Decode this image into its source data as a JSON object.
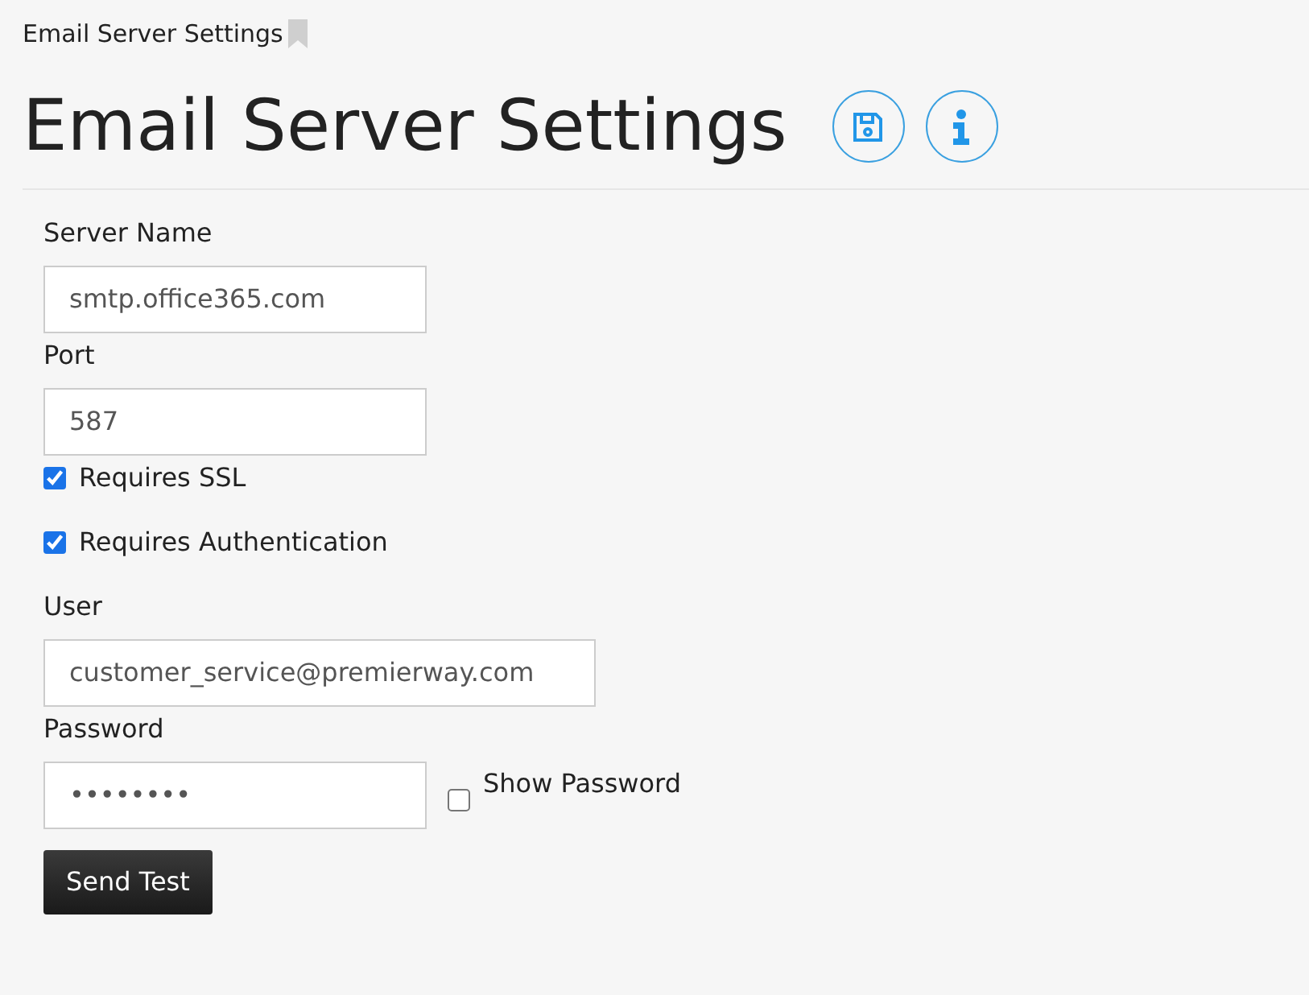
{
  "breadcrumb": {
    "title": "Email Server Settings",
    "bookmarked": false
  },
  "page": {
    "title": "Email Server Settings"
  },
  "form": [
    {
      "kind": "text",
      "label": "Server Name",
      "value": "smtp.office365.com",
      "wide": false
    },
    {
      "kind": "text",
      "label": "Port",
      "value": "587",
      "wide": false
    },
    {
      "kind": "checkbox",
      "label": "Requires SSL",
      "checked": true
    },
    {
      "kind": "checkbox",
      "label": "Requires Authentication",
      "checked": true
    },
    {
      "kind": "text",
      "label": "User",
      "value": "customer_service@premierway.com",
      "wide": true
    },
    {
      "kind": "password",
      "label": "Password",
      "value": "••••••••",
      "toggle_label": "Show Password",
      "checked": false
    }
  ],
  "buttons": [
    "Send Test"
  ]
}
